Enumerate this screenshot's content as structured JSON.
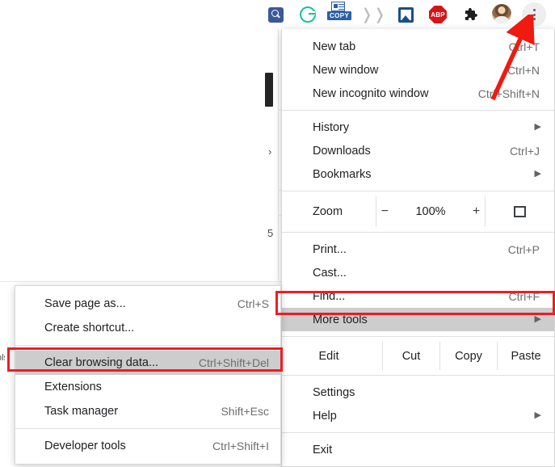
{
  "toolbar": {
    "icons": [
      {
        "name": "search-extension-icon",
        "label": "Search extension"
      },
      {
        "name": "grammarly-icon",
        "label": "Grammarly"
      },
      {
        "name": "copy-extension-icon",
        "label": "COPY",
        "badge": "COPY"
      },
      {
        "name": "chevrons-icon",
        "label": "Extension"
      },
      {
        "name": "image-extension-icon",
        "label": "Image extension"
      },
      {
        "name": "adblock-plus-icon",
        "label": "ABP",
        "badge": "ABP"
      },
      {
        "name": "extensions-puzzle-icon",
        "label": "Extensions"
      },
      {
        "name": "profile-avatar",
        "label": "Profile"
      },
      {
        "name": "chrome-menu-kebab-icon",
        "label": "Customize and control Google Chrome"
      }
    ]
  },
  "main_menu": {
    "groups": [
      {
        "items": [
          {
            "label": "New tab",
            "accel": "Ctrl+T",
            "submenu": false,
            "highlighted": false
          },
          {
            "label": "New window",
            "accel": "Ctrl+N",
            "submenu": false,
            "highlighted": false
          },
          {
            "label": "New incognito window",
            "accel": "Ctrl+Shift+N",
            "submenu": false,
            "highlighted": false
          }
        ]
      },
      {
        "items": [
          {
            "label": "History",
            "accel": "",
            "submenu": true,
            "highlighted": false
          },
          {
            "label": "Downloads",
            "accel": "Ctrl+J",
            "submenu": false,
            "highlighted": false
          },
          {
            "label": "Bookmarks",
            "accel": "",
            "submenu": true,
            "highlighted": false
          }
        ]
      },
      {
        "items": [
          {
            "label": "Print...",
            "accel": "Ctrl+P",
            "submenu": false,
            "highlighted": false
          },
          {
            "label": "Cast...",
            "accel": "",
            "submenu": false,
            "highlighted": false
          },
          {
            "label": "Find...",
            "accel": "Ctrl+F",
            "submenu": false,
            "highlighted": false
          },
          {
            "label": "More tools",
            "accel": "",
            "submenu": true,
            "highlighted": true
          }
        ]
      },
      {
        "items": [
          {
            "label": "Settings",
            "accel": "",
            "submenu": false,
            "highlighted": false
          },
          {
            "label": "Help",
            "accel": "",
            "submenu": true,
            "highlighted": false
          }
        ]
      },
      {
        "items": [
          {
            "label": "Exit",
            "accel": "",
            "submenu": false,
            "highlighted": false
          }
        ]
      }
    ],
    "zoom_row": {
      "label": "Zoom",
      "minus": "−",
      "value": "100%",
      "plus": "+",
      "fullscreen_icon": "fullscreen-icon"
    },
    "edit_row": {
      "label": "Edit",
      "actions": [
        "Cut",
        "Copy",
        "Paste"
      ]
    }
  },
  "submenu": {
    "title": "More tools",
    "groups": [
      {
        "items": [
          {
            "label": "Save page as...",
            "accel": "Ctrl+S",
            "highlighted": false
          },
          {
            "label": "Create shortcut...",
            "accel": "",
            "highlighted": false
          }
        ]
      },
      {
        "items": [
          {
            "label": "Clear browsing data...",
            "accel": "Ctrl+Shift+Del",
            "highlighted": true
          },
          {
            "label": "Extensions",
            "accel": "",
            "highlighted": false
          },
          {
            "label": "Task manager",
            "accel": "Shift+Esc",
            "highlighted": false
          }
        ]
      },
      {
        "items": [
          {
            "label": "Developer tools",
            "accel": "Ctrl+Shift+I",
            "highlighted": false
          }
        ]
      }
    ]
  },
  "annotations": {
    "highlight_color": "#ee1c23",
    "arrow": {
      "name": "red-arrow-pointer",
      "points_to": "chrome-menu-kebab-icon"
    },
    "boxes": [
      {
        "name": "highlight-more-tools",
        "target": "More tools"
      },
      {
        "name": "highlight-clear-browsing-data",
        "target": "Clear browsing data..."
      }
    ]
  },
  "background": {
    "fragments": [
      {
        "text": "›"
      },
      {
        "text": "5"
      },
      {
        "text": "ols"
      }
    ]
  }
}
